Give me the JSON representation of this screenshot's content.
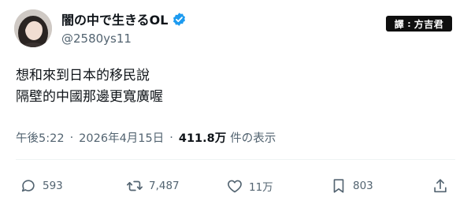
{
  "author": {
    "display_name": "闇の中で生きるOL",
    "handle": "@2580ys11"
  },
  "stamp": {
    "label": "譯",
    "translator": "方吉君"
  },
  "tweet": {
    "lines": [
      "想和來到日本的移民說",
      "隔壁的中國那邊更寬廣喔"
    ]
  },
  "meta": {
    "time": "午後5:22",
    "date": "2026年4月15日",
    "views": "411.8万",
    "views_label": "件の表示",
    "separator": "·"
  },
  "actions": {
    "replies": "593",
    "reposts": "7,487",
    "likes": "11万",
    "bookmarks": "803"
  },
  "colors": {
    "verified": "#1d9bf0",
    "muted_text": "#536471",
    "main_text": "#0f1419"
  },
  "icons": [
    "verified-badge-icon",
    "reply-icon",
    "repost-icon",
    "like-icon",
    "bookmark-icon",
    "share-icon"
  ]
}
